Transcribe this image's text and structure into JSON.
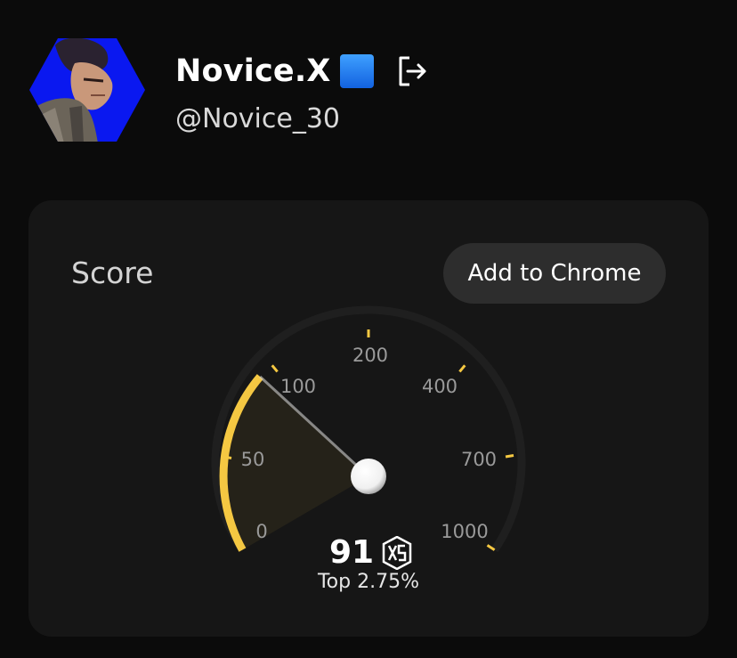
{
  "profile": {
    "display_name": "Novice.X",
    "handle": "@Novice_30",
    "avatar": "hexagon-avatar-anime-character",
    "verified_badge": "blue-square-icon",
    "logout_icon": "logout-icon"
  },
  "score_card": {
    "title": "Score",
    "add_to_chrome_label": "Add to Chrome",
    "gauge": {
      "ticks": [
        "0",
        "50",
        "100",
        "200",
        "400",
        "700",
        "1000"
      ],
      "value": 91,
      "accent_color": "#f5c842"
    },
    "score_value": "91",
    "score_icon": "xs-logo-icon",
    "rank_text": "Top 2.75%"
  }
}
